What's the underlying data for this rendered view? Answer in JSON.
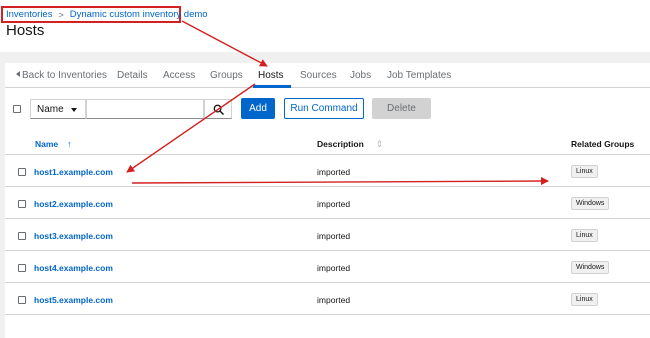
{
  "breadcrumb": {
    "items": [
      "Inventories",
      "Dynamic custom inventory demo"
    ],
    "separator": ">"
  },
  "page": {
    "title": "Hosts"
  },
  "tabs": {
    "back_label": "Back to Inventories",
    "items": [
      "Details",
      "Access",
      "Groups",
      "Hosts",
      "Sources",
      "Jobs",
      "Job Templates"
    ],
    "active": "Hosts"
  },
  "toolbar": {
    "filter_select": "Name",
    "search_value": "",
    "add_label": "Add",
    "run_command_label": "Run Command",
    "delete_label": "Delete"
  },
  "table": {
    "columns": {
      "name": "Name",
      "description": "Description",
      "related_groups": "Related Groups"
    },
    "sort_indicator": "↑",
    "rows": [
      {
        "name": "host1.example.com",
        "description": "imported",
        "group": "Linux"
      },
      {
        "name": "host2.example.com",
        "description": "imported",
        "group": "Windows"
      },
      {
        "name": "host3.example.com",
        "description": "imported",
        "group": "Linux"
      },
      {
        "name": "host4.example.com",
        "description": "imported",
        "group": "Windows"
      },
      {
        "name": "host5.example.com",
        "description": "imported",
        "group": "Linux"
      }
    ]
  },
  "colors": {
    "accent": "#0066cc",
    "annotation": "#d32020",
    "disabled": "#d2d2d2"
  },
  "icons": [
    "caret-left-icon",
    "search-icon",
    "chevron-down-icon",
    "sort-ascending-icon"
  ]
}
